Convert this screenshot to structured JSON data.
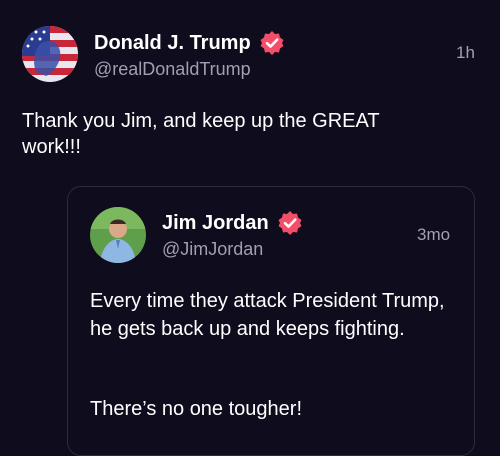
{
  "post": {
    "author_name": "Donald J. Trump",
    "handle": "@realDonaldTrump",
    "time": "1h",
    "text": "Thank you Jim, and keep up the GREAT work!!!",
    "verified": true
  },
  "quoted_post": {
    "author_name": "Jim Jordan",
    "handle": "@JimJordan",
    "time": "3mo",
    "text_line_1": "Every time they attack President Trump, he gets back up and keeps fighting.",
    "text_line_2": "There’s no one tougher!",
    "verified": true
  },
  "colors": {
    "background": "#0f0c1d",
    "muted_text": "#a39fb3",
    "verified_badge": "#f24e6a",
    "card_border": "#2e2a40"
  }
}
